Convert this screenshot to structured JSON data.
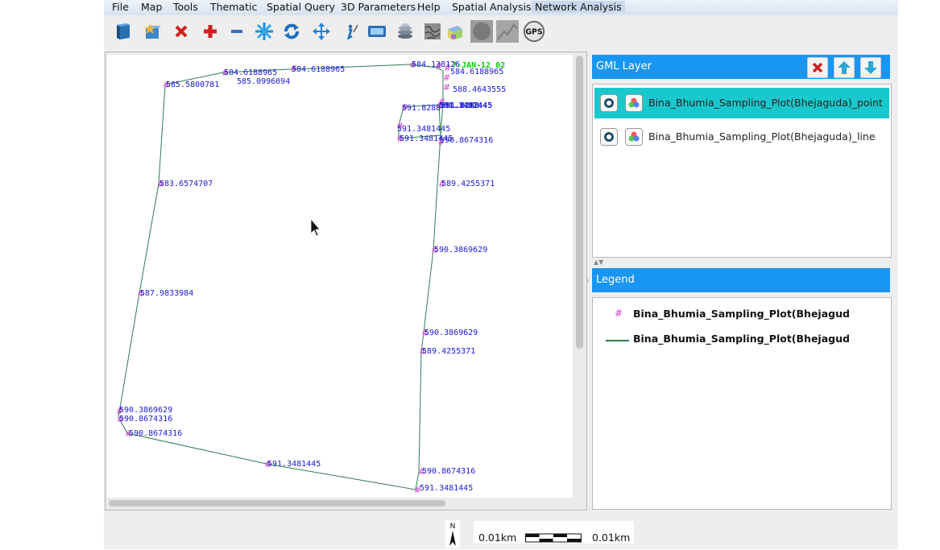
{
  "menu": [
    "File",
    "Map",
    "Tools",
    "Thematic",
    "Spatial Query",
    "3D Parameters",
    "Help",
    "Spatial Analysis",
    "Network Analysis"
  ],
  "toolbar": {
    "icons": [
      "open-layer",
      "add-layer",
      "remove-layer",
      "zoom-in",
      "zoom-out",
      "zoom-extent",
      "refresh",
      "pan",
      "identify",
      "select-rectangle",
      "layer-stack",
      "topography",
      "3d-view",
      "buffer",
      "terrain",
      "gps"
    ],
    "gps_label": "GPS"
  },
  "map": {
    "date_label": "7-JAN-12 02",
    "date_color": "#00d000",
    "label_color": "#1a1ad6",
    "marker_color": "#cc44cc",
    "line_color": "#2e7d4f",
    "points": [
      {
        "text": "584.6188965"
      },
      {
        "text": "585.5800781"
      },
      {
        "text": "585.0996094"
      },
      {
        "text": "584.6188965"
      },
      {
        "text": "584.138126"
      },
      {
        "text": "584.6188965"
      },
      {
        "text": "588.4643555"
      },
      {
        "text": "591.8288"
      },
      {
        "text": "591.3481445"
      },
      {
        "text": "591.3481445"
      },
      {
        "text": "590.8674316"
      },
      {
        "text": "583.6574707"
      },
      {
        "text": "589.4255371"
      },
      {
        "text": "590.3869629"
      },
      {
        "text": "587.9833984"
      },
      {
        "text": "590.3869629"
      },
      {
        "text": "589.4255371"
      },
      {
        "text": "590.3869629"
      },
      {
        "text": "590.8674316"
      },
      {
        "text": "590.8674316"
      },
      {
        "text": "591.3481445"
      },
      {
        "text": "590.8674316"
      },
      {
        "text": "591.3481445"
      }
    ]
  },
  "gml_panel": {
    "title": "GML Layer",
    "layers": [
      {
        "name": "Bina_Bhumia_Sampling_Plot(Bhejaguda)_point",
        "selected": true
      },
      {
        "name": "Bina_Bhumia_Sampling_Plot(Bhejaguda)_line",
        "selected": false
      }
    ]
  },
  "legend": {
    "title": "Legend",
    "items": [
      {
        "symbol": "#",
        "label": "Bina_Bhumia_Sampling_Plot(Bhejagud"
      },
      {
        "symbol": "line",
        "label": "Bina_Bhumia_Sampling_Plot(Bhejagud"
      }
    ]
  },
  "statusbar": {
    "north": "N",
    "scale_left": "0.01km",
    "scale_right": "0.01km"
  },
  "colors": {
    "accent": "#1996f3",
    "selected_row": "#18c8cc"
  }
}
